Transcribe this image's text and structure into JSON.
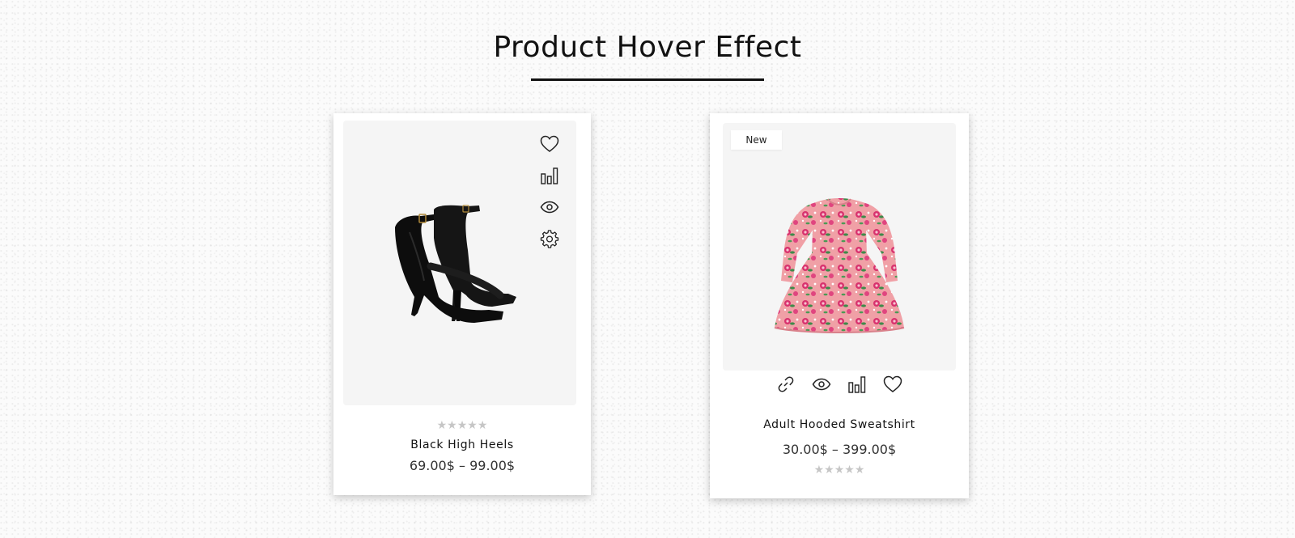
{
  "page": {
    "title": "Product Hover Effect"
  },
  "products": [
    {
      "name": "Black High Heels",
      "price": "69.00$ – 99.00$",
      "rating_stars": "★★★★★",
      "rating": 0,
      "actions": [
        "heart-icon",
        "compare-icon",
        "eye-icon",
        "gear-icon"
      ]
    },
    {
      "name": "Adult Hooded Sweatshirt",
      "price": "30.00$ – 399.00$",
      "badge": "New",
      "rating_stars": "★★★★★",
      "rating": 0,
      "actions": [
        "link-icon",
        "eye-icon",
        "compare-icon",
        "heart-icon"
      ]
    }
  ],
  "colors": {
    "card_bg": "#ffffff",
    "image_bg": "#f5f5f5",
    "star_empty": "#c6c6c6",
    "text": "#111111"
  }
}
